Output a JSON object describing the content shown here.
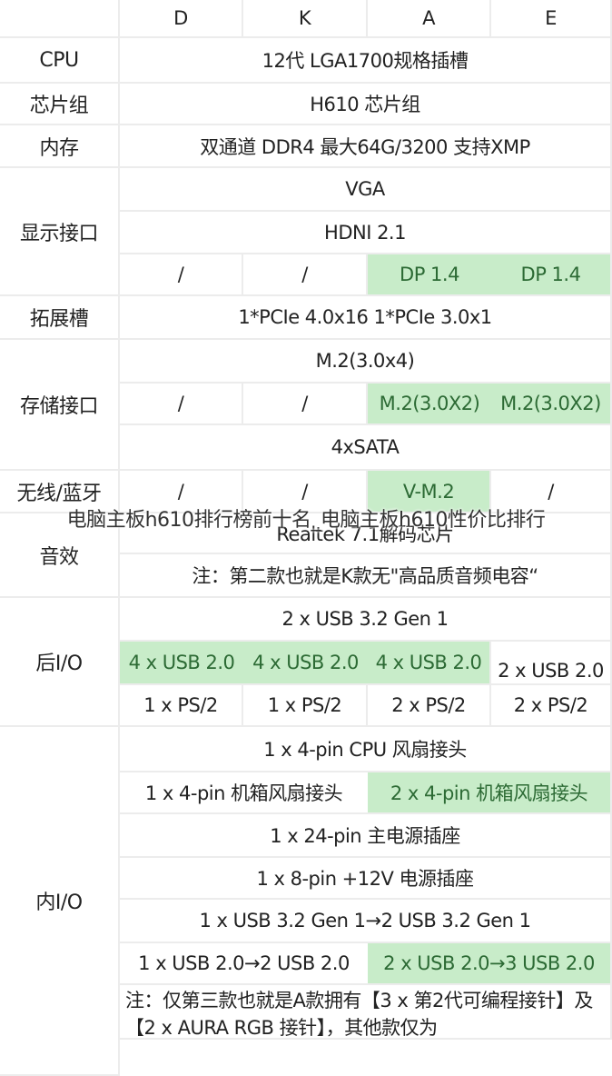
{
  "header": {
    "columns": [
      "D",
      "K",
      "A",
      "E"
    ]
  },
  "rows": {
    "cpu": {
      "label": "CPU",
      "value": "12代 LGA1700规格插槽"
    },
    "chipset": {
      "label": "芯片组",
      "value": "H610 芯片组"
    },
    "memory": {
      "label": "内存",
      "value": "双通道 DDR4 最大64G/3200 支持XMP"
    },
    "display": {
      "label": "显示接口",
      "vga": "VGA",
      "hdmi": "HDNI 2.1",
      "dp": [
        "/",
        "/",
        "DP 1.4",
        "DP 1.4"
      ]
    },
    "expansion": {
      "label": "拓展槽",
      "value": "1*PCIe 4.0x16 1*PCIe 3.0x1"
    },
    "storage": {
      "label": "存储接口",
      "m2_main": "M.2(3.0x4)",
      "m2_extra": [
        "/",
        "/",
        "M.2(3.0X2)",
        "M.2(3.0X2)"
      ],
      "sata": "4xSATA"
    },
    "wireless": {
      "label": "无线/蓝牙",
      "values": [
        "/",
        "/",
        "V-M.2",
        "/"
      ]
    },
    "audio": {
      "label": "音效",
      "codec": "Realtek 7.1解码芯片",
      "note": "注：第二款也就是K款无\"高品质音频电容“"
    },
    "rear_io": {
      "label": "后I/O",
      "usb32": "2 x USB 3.2 Gen 1",
      "usb20": [
        "4 x USB 2.0",
        "4 x USB 2.0",
        "4 x USB 2.0",
        "2 x USB 2.0"
      ],
      "ps2": [
        "1 x PS/2",
        "1 x PS/2",
        "2 x PS/2",
        "2 x PS/2"
      ]
    },
    "internal_io": {
      "label": "内I/O",
      "cpu_fan": "1 x 4-pin CPU 风扇接头",
      "case_fan": [
        "1 x 4-pin 机箱风扇接头",
        "2 x 4-pin 机箱风扇接头"
      ],
      "atx24": "1 x 24-pin 主电源插座",
      "eps8": "1 x 8-pin +12V 电源插座",
      "usb32": "1 x USB 3.2 Gen 1→2 USB 3.2 Gen 1",
      "usb20": [
        "1 x USB 2.0→2 USB 2.0",
        "2 x USB 2.0→3 USB 2.0"
      ],
      "note": "注：仅第三款也就是A款拥有【3 x 第2代可编程接针】及【2 x AURA RGB 接针】，其他款仅为"
    }
  },
  "watermark": "电脑主板h610排行榜前十名_电脑主板h610性价比排行",
  "colors": {
    "highlight_bg": "#c8ecc9",
    "highlight_text": "#2c6a34",
    "grid": "#ececec"
  }
}
